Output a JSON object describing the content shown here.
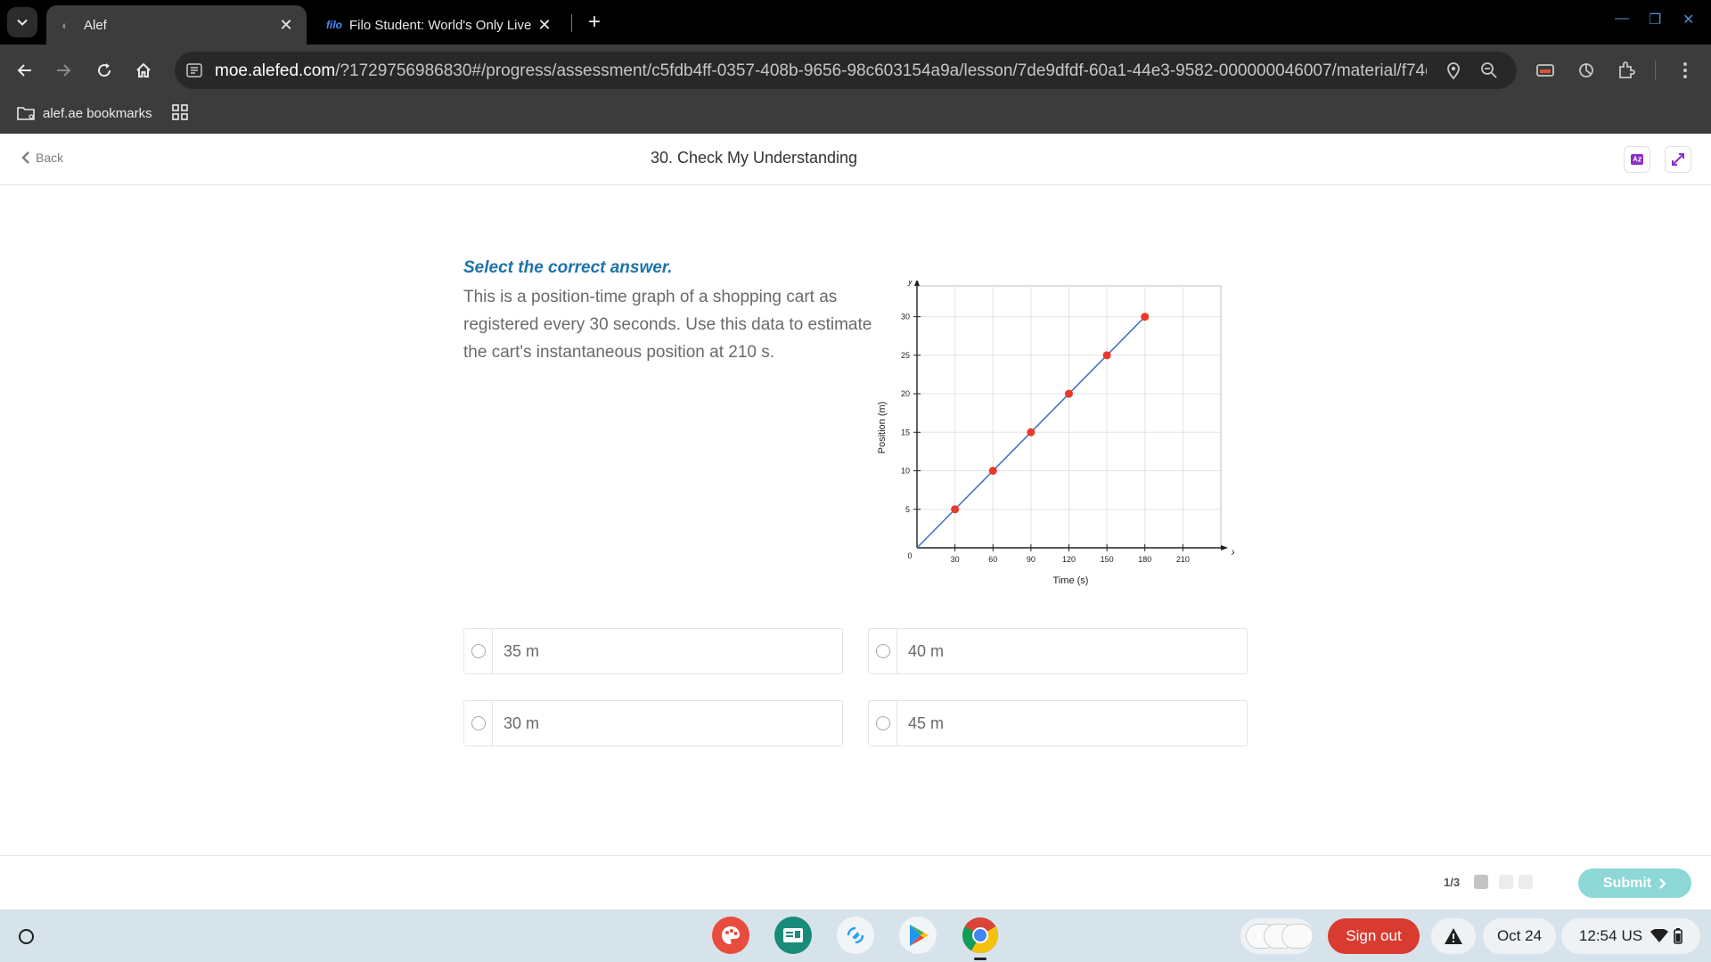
{
  "browser": {
    "tabs": [
      {
        "title": "Alef",
        "active": true
      },
      {
        "title": "Filo Student: World's Only Live",
        "favicon_text": "filo",
        "active": false
      }
    ],
    "url_host": "moe.alefed.com",
    "url_path": "/?1729756986830#/progress/assessment/c5fdb4ff-0357-408b-9656-98c603154a9a/lesson/7de9dfdf-60a1-44e3-9582-000000046007/material/f74d3e9a-ae...",
    "bookmarks": [
      {
        "label": "alef.ae bookmarks"
      }
    ]
  },
  "header": {
    "back_label": "Back",
    "title": "30. Check My Understanding"
  },
  "question": {
    "instruction": "Select the correct answer.",
    "text": "This is a position-time graph of a shopping cart as registered every 30 seconds. Use this data to estimate the cart's instantaneous position at 210 s."
  },
  "chart_data": {
    "type": "line",
    "xlabel": "Time (s)",
    "ylabel": "Position (m)",
    "x_axis_letter": "x",
    "y_axis_letter": "y",
    "origin_label": "0",
    "x_ticks": [
      30,
      60,
      90,
      120,
      150,
      180,
      210
    ],
    "y_ticks": [
      5,
      10,
      15,
      20,
      25,
      30
    ],
    "xlim": [
      0,
      240
    ],
    "ylim": [
      0,
      34
    ],
    "grid": true,
    "line": {
      "x": [
        0,
        180
      ],
      "y": [
        0,
        30
      ]
    },
    "points": {
      "x": [
        30,
        60,
        90,
        120,
        150,
        180
      ],
      "y": [
        5,
        10,
        15,
        20,
        25,
        30
      ]
    },
    "colors": {
      "line": "#4472c4",
      "points": "#e8392a"
    }
  },
  "options": [
    {
      "label": "35 m"
    },
    {
      "label": "40 m"
    },
    {
      "label": "30 m"
    },
    {
      "label": "45 m"
    }
  ],
  "footer": {
    "progress_label": "1/3",
    "submit_label": "Submit"
  },
  "shelf": {
    "signout_label": "Sign out",
    "date": "Oct 24",
    "time": "12:54",
    "locale": "US"
  },
  "colors": {
    "accent_blue": "#1d73a8",
    "submit_teal": "#8dd8d6",
    "signout_red": "#d93b30"
  }
}
